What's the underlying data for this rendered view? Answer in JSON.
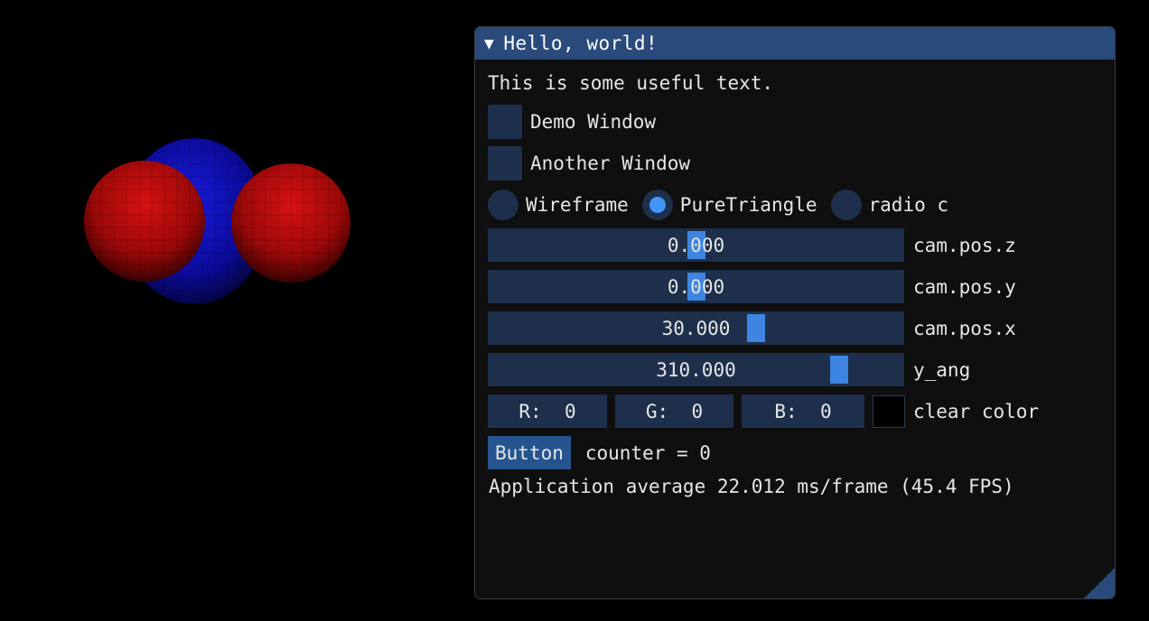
{
  "window": {
    "title": "Hello, world!",
    "text": "This is some useful text.",
    "checkboxes": [
      {
        "label": "Demo Window",
        "checked": false
      },
      {
        "label": "Another Window",
        "checked": false
      }
    ],
    "radios": [
      {
        "label": "Wireframe",
        "selected": false
      },
      {
        "label": "PureTriangle",
        "selected": true
      },
      {
        "label": "radio c",
        "selected": false
      }
    ],
    "sliders": [
      {
        "label": "cam.pos.z",
        "value": "0.000",
        "fraction": 0.5
      },
      {
        "label": "cam.pos.y",
        "value": "0.000",
        "fraction": 0.5
      },
      {
        "label": "cam.pos.x",
        "value": "30.000",
        "fraction": 0.65
      },
      {
        "label": "y_ang",
        "value": "310.000",
        "fraction": 0.86
      }
    ],
    "color": {
      "r_label": "R:  0",
      "g_label": "G:  0",
      "b_label": "B:  0",
      "label": "clear color",
      "swatch_hex": "#000000"
    },
    "button_label": "Button",
    "counter_text": "counter = 0",
    "fps_text": "Application average 22.012 ms/frame (45.4 FPS)"
  },
  "colors": {
    "frame_bg": "#1d2f4b",
    "slider_grab": "#3d85e0",
    "title_bg": "#294a7a",
    "button_bg": "#25548f",
    "sphere_red": "#c00000",
    "sphere_blue": "#1010c8"
  }
}
